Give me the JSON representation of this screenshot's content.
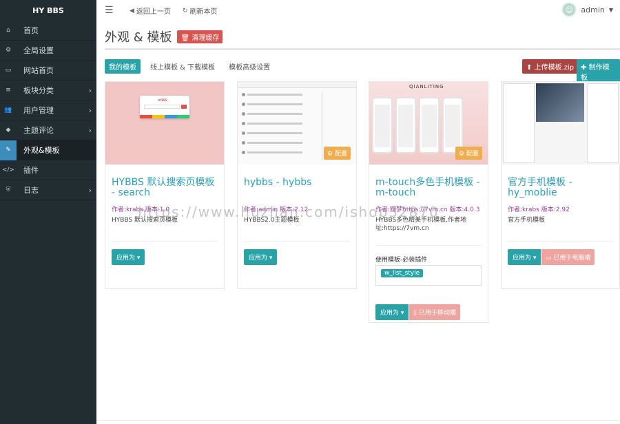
{
  "brand": "HY BBS",
  "topbar": {
    "back_label": "返回上一页",
    "refresh_label": "刷新本页",
    "username": "admin"
  },
  "sidebar": {
    "items": [
      {
        "label": "首页",
        "icon": "home-icon"
      },
      {
        "label": "全局设置",
        "icon": "gear-icon"
      },
      {
        "label": "网站首页",
        "icon": "monitor-icon"
      },
      {
        "label": "板块分类",
        "icon": "list-icon"
      },
      {
        "label": "用户管理",
        "icon": "users-icon"
      },
      {
        "label": "主题评论",
        "icon": "tag-icon"
      },
      {
        "label": "外观&模板",
        "icon": "brush-icon"
      },
      {
        "label": "插件",
        "icon": "code-icon"
      },
      {
        "label": "日志",
        "icon": "shield-icon"
      }
    ]
  },
  "page": {
    "title": "外观 & 模板",
    "clear_cache": "清理缓存"
  },
  "tabs": [
    "我的模板",
    "线上模板 & 下载模板",
    "模板高级设置"
  ],
  "actions": {
    "upload": "上传模板.zip",
    "make": "制作模板"
  },
  "cards": [
    {
      "title": "HYBBS 默认搜索页模板 - search",
      "meta": "作者:krabs 版本:1.0",
      "desc": "HYBBS 默认搜索页模板",
      "apply": "应用为"
    },
    {
      "title": "hybbs - hybbs",
      "meta": "作者:admin 版本:2.12",
      "desc": "HYBBS2.0主题模板",
      "apply": "应用为",
      "config": "配置"
    },
    {
      "title": "m-touch多色手机模板 - m-touch",
      "meta": "作者:阀梦https://7vm.cn 版本:4.0.3",
      "desc": "HYBBS多色精美手机模板,作者地址:https://7vm.cn",
      "thumb_title": "QIANLITING",
      "config": "配置",
      "plugin_label": "使用模板-必装插件",
      "plugin_tag": "w_list_style",
      "apply": "应用为",
      "state": "已用于移动端"
    },
    {
      "title": "官方手机模板 - hy_moblie",
      "meta": "作者:krabs 版本:2.92",
      "desc": "官方手机模板",
      "apply": "应用为",
      "state": "已用于电脑端"
    }
  ],
  "watermark": "https://www.huzhan.com/ishop32870",
  "colors": {
    "sidebar_bg": "#222d32",
    "accent_teal": "#2aa3a8",
    "danger": "#d9534f",
    "title_blue": "#2a9fbc",
    "meta_purple": "#9b3b9e"
  }
}
